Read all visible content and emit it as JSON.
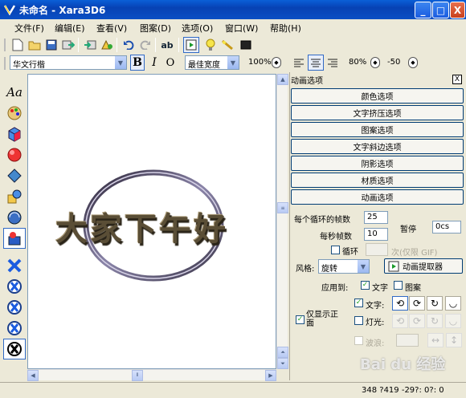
{
  "window": {
    "title": "未命名 - Xara3D6",
    "min": "_",
    "max": "□",
    "close": "X"
  },
  "menu": [
    "文件(F)",
    "编辑(E)",
    "查看(V)",
    "图案(D)",
    "选项(O)",
    "窗口(W)",
    "帮助(H)"
  ],
  "toolbar2": {
    "font": "华文行楷",
    "bold": "B",
    "italic": "I",
    "outline": "O",
    "width_mode": "最佳宽度",
    "zoom": "100%",
    "line_spacing": "80%",
    "kerning": "-50"
  },
  "canvas": {
    "text": "大家下午好"
  },
  "panel": {
    "title": "动画选项",
    "close": "X",
    "sections": [
      "颜色选项",
      "文字挤压选项",
      "图案选项",
      "文字斜边选项",
      "阴影选项",
      "材质选项",
      "动画选项"
    ],
    "frames_per_loop_label": "每个循环的帧数",
    "frames_per_loop": "25",
    "fps_label": "每秒帧数",
    "fps": "10",
    "pause_label": "暂停",
    "pause": "0cs",
    "loop_label": "循环",
    "times_label": "次(仅限 GIF)",
    "style_label": "风格:",
    "style": "旋转",
    "extract_btn": "动画提取器",
    "apply_label": "应用到:",
    "apply_text": "文字",
    "apply_pattern": "图案",
    "text_label": "文字:",
    "light_label": "灯光:",
    "wave_label": "波浪:",
    "show_only_label": "仅显示正面"
  },
  "status": "348 ?419  -29?: 0?: 0",
  "watermark": "Bai du 经验"
}
